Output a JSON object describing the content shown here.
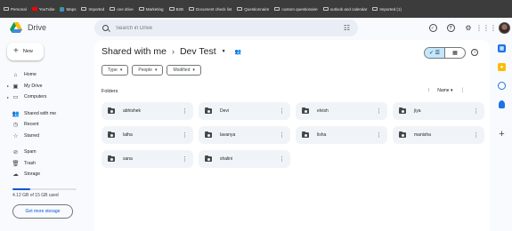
{
  "bookmarks": [
    {
      "label": "Personal",
      "icon": "folder-icon"
    },
    {
      "label": "YouTube",
      "icon": "youtube-icon"
    },
    {
      "label": "Maps",
      "icon": "maps-icon"
    },
    {
      "label": "Imported",
      "icon": "folder-icon"
    },
    {
      "label": "one drive",
      "icon": "folder-icon"
    },
    {
      "label": "Marketing",
      "icon": "folder-icon"
    },
    {
      "label": "B2B",
      "icon": "folder-icon"
    },
    {
      "label": "Document check list",
      "icon": "folder-icon"
    },
    {
      "label": "Questionnaire",
      "icon": "folder-icon"
    },
    {
      "label": "custom questionaire",
      "icon": "folder-icon"
    },
    {
      "label": "outlook and calendar",
      "icon": "folder-icon"
    },
    {
      "label": "Imported (1)",
      "icon": "folder-icon"
    }
  ],
  "app": {
    "name": "Drive"
  },
  "search": {
    "placeholder": "Search in Drive"
  },
  "sidebar": {
    "new_label": "New",
    "items": [
      {
        "label": "Home",
        "icon": "home-icon"
      },
      {
        "label": "My Drive",
        "icon": "my-drive-icon"
      },
      {
        "label": "Computers",
        "icon": "computers-icon"
      },
      {
        "label": "Shared with me",
        "icon": "shared-icon"
      },
      {
        "label": "Recent",
        "icon": "clock-icon"
      },
      {
        "label": "Starred",
        "icon": "star-icon"
      },
      {
        "label": "Spam",
        "icon": "spam-icon"
      },
      {
        "label": "Trash",
        "icon": "trash-icon"
      },
      {
        "label": "Storage",
        "icon": "cloud-icon"
      }
    ],
    "storage_text": "4.12 GB of 15 GB used",
    "storage_fraction": 0.275,
    "get_storage_label": "Get more storage"
  },
  "breadcrumb": {
    "parent": "Shared with me",
    "current": "Dev Test"
  },
  "filters": [
    "Type",
    "People",
    "Modified"
  ],
  "folders_section": {
    "label": "Folders",
    "sort_label": "Name"
  },
  "folders": [
    "abhishek",
    "Devi",
    "elvish",
    "jiya",
    "latha",
    "lavanya",
    "lisha",
    "manisha",
    "sana",
    "shalini"
  ],
  "colors": {
    "accent": "#0b57d0",
    "toggle_active": "#c2e7ff",
    "card_bg": "#f0f4f9",
    "bookmarks_bg": "#3c3c3c"
  }
}
